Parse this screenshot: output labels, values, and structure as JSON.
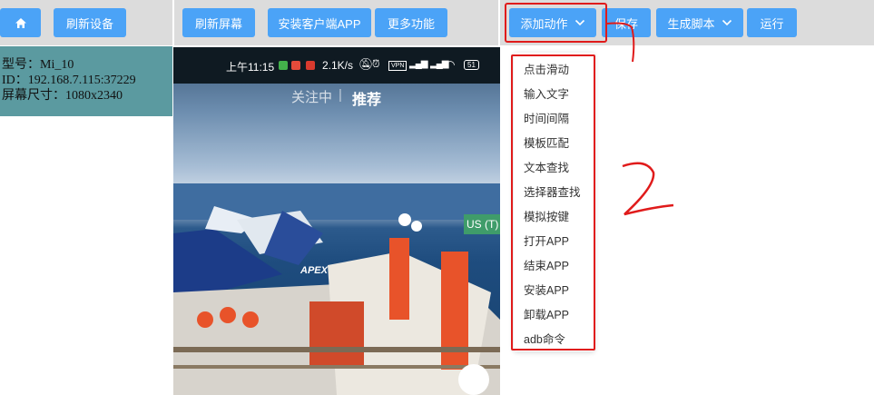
{
  "toolbar": {
    "home_icon": "home-icon",
    "refresh_device": "刷新设备",
    "refresh_screen": "刷新屏幕",
    "install_client": "安装客户端APP",
    "more_functions": "更多功能",
    "add_action": "添加动作",
    "save": "保存",
    "generate_script": "生成脚本",
    "run": "运行"
  },
  "device": {
    "model": "型号：Mi_10",
    "id": "ID：192.168.7.115:37229",
    "screen_size": "屏幕尺寸：1080x2340"
  },
  "phone": {
    "time": "上午11:15",
    "speed": "2.1K/s",
    "battery": "51",
    "tab_follow": "关注中",
    "tab_recommend": "推荐",
    "badge": "US (T)",
    "ship_text": "APEX"
  },
  "menu": {
    "items": [
      "点击滑动",
      "输入文字",
      "时间间隔",
      "模板匹配",
      "文本查找",
      "选择器查找",
      "模拟按键",
      "打开APP",
      "结束APP",
      "安装APP",
      "卸载APP",
      "adb命令"
    ]
  },
  "annotation": {
    "number": "2"
  },
  "colors": {
    "button": "#4ba3f7",
    "toolbar_bg": "#dcdcdc",
    "device_card": "#5b9aa0",
    "highlight": "#e01b1b"
  }
}
